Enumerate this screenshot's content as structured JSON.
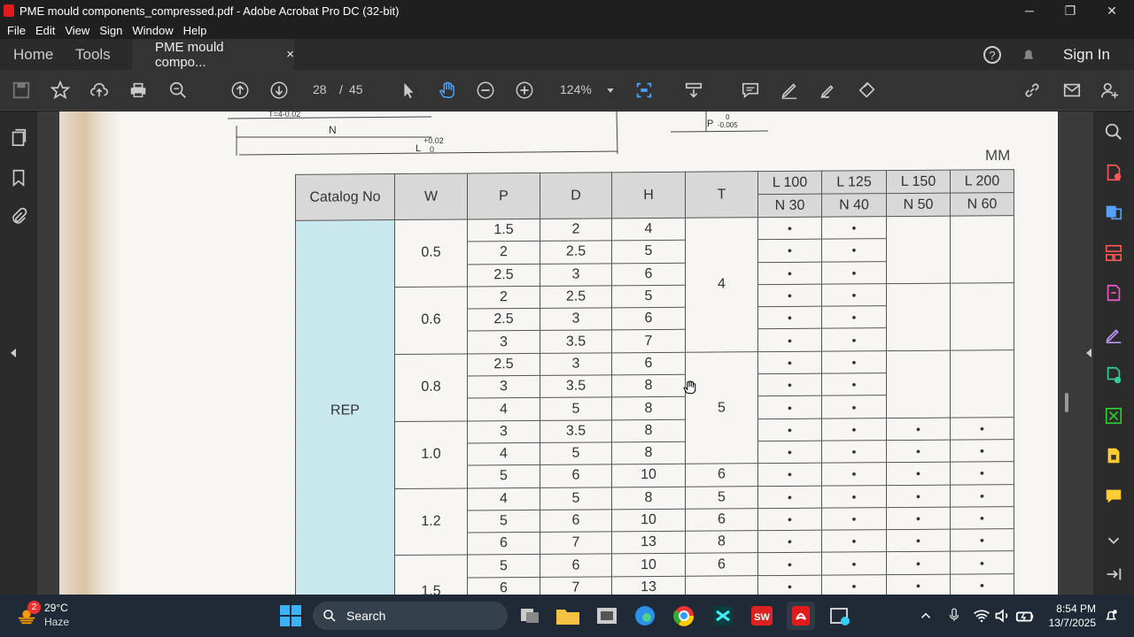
{
  "window": {
    "title": "PME mould components_compressed.pdf - Adobe Acrobat Pro DC (32-bit)",
    "minimize": "─",
    "maximize": "❐",
    "close": "✕"
  },
  "menu": [
    "File",
    "Edit",
    "View",
    "Sign",
    "Window",
    "Help"
  ],
  "tabs": {
    "home": "Home",
    "tools": "Tools",
    "doc": "PME mould compo...",
    "close": "×",
    "signin": "Sign In"
  },
  "toolbar": {
    "page_current": "28",
    "page_sep": "/",
    "page_total": "45",
    "zoom": "124%"
  },
  "drawing": {
    "unit": "MM",
    "n_label": "N",
    "l_label": "L",
    "l_tol": "+0.02",
    "l_tol0": "0",
    "p_label": "P",
    "p_tol": "0",
    "p_tol2": "-0.005",
    "t_tol": "T=4-0.02"
  },
  "table": {
    "headers": {
      "catalog": "Catalog No",
      "w": "W",
      "p": "P",
      "d": "D",
      "h": "H",
      "t": "T",
      "l100": "L 100",
      "l125": "L 125",
      "l150": "L 150",
      "l200": "L 200",
      "n30": "N 30",
      "n40": "N 40",
      "n50": "N 50",
      "n60": "N 60"
    },
    "catalog": "REP",
    "w_groups": [
      "0.5",
      "0.6",
      "0.8",
      "1.0",
      "1.2",
      "1.5"
    ],
    "rows": [
      {
        "p": "1.5",
        "d": "2",
        "h": "4"
      },
      {
        "p": "2",
        "d": "2.5",
        "h": "5"
      },
      {
        "p": "2.5",
        "d": "3",
        "h": "6"
      },
      {
        "p": "2",
        "d": "2.5",
        "h": "5"
      },
      {
        "p": "2.5",
        "d": "3",
        "h": "6"
      },
      {
        "p": "3",
        "d": "3.5",
        "h": "7"
      },
      {
        "p": "2.5",
        "d": "3",
        "h": "6"
      },
      {
        "p": "3",
        "d": "3.5",
        "h": "8"
      },
      {
        "p": "4",
        "d": "5",
        "h": "8"
      },
      {
        "p": "3",
        "d": "3.5",
        "h": "8"
      },
      {
        "p": "4",
        "d": "5",
        "h": "8"
      },
      {
        "p": "5",
        "d": "6",
        "h": "10"
      },
      {
        "p": "4",
        "d": "5",
        "h": "8"
      },
      {
        "p": "5",
        "d": "6",
        "h": "10"
      },
      {
        "p": "6",
        "d": "7",
        "h": "13"
      },
      {
        "p": "5",
        "d": "6",
        "h": "10"
      },
      {
        "p": "6",
        "d": "7",
        "h": "13"
      }
    ],
    "t_values": {
      "t4": "4",
      "t5": "5",
      "t6a": "6",
      "t5b": "5",
      "t6b": "6",
      "t8": "8",
      "t6c": "6"
    },
    "dot": "•"
  },
  "taskbar": {
    "temp": "29°C",
    "weather": "Haze",
    "search": "Search",
    "time": "8:54 PM",
    "date": "13/7/2025",
    "badge": "2"
  }
}
